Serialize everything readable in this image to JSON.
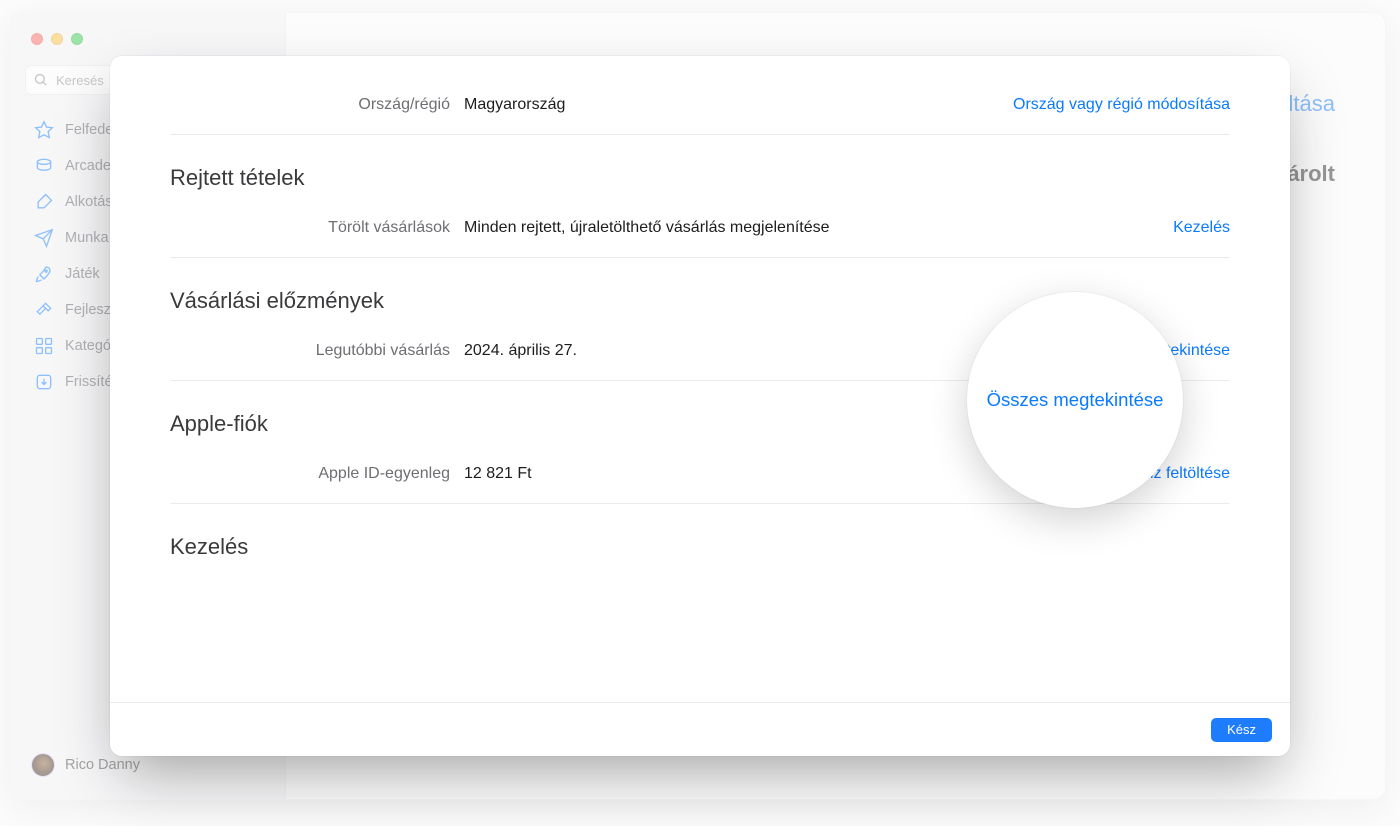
{
  "colors": {
    "accent": "#0a7aff"
  },
  "sidebar": {
    "search_placeholder": "Keresés",
    "items": [
      "Felfedezés",
      "Arcade",
      "Alkotás",
      "Munka",
      "Játék",
      "Fejlesztés",
      "Kategóriák",
      "Frissítések"
    ],
    "user_name": "Rico Danny"
  },
  "main_bg": {
    "link_partial": "áltása",
    "text_partial": "sárolt"
  },
  "modal": {
    "region": {
      "label": "Ország/régió",
      "value": "Magyarország",
      "action": "Ország vagy régió módosítása"
    },
    "hidden": {
      "title": "Rejtett tételek",
      "deleted_label": "Törölt vásárlások",
      "deleted_value": "Minden rejtett, újraletölthető vásárlás megjelenítése",
      "deleted_action": "Kezelés"
    },
    "history": {
      "title": "Vásárlási előzmények",
      "last_label": "Legutóbbi vásárlás",
      "last_value": "2024. április 27.",
      "view_all": "Összes megtekintése"
    },
    "account": {
      "title": "Apple-fiók",
      "balance_label": "Apple ID-egyenleg",
      "balance_value": "12 821 Ft",
      "add_funds": "Pénz feltöltése"
    },
    "manage": {
      "title": "Kezelés"
    },
    "done": "Kész"
  },
  "magnifier": {
    "text": "Összes megtekintése"
  }
}
